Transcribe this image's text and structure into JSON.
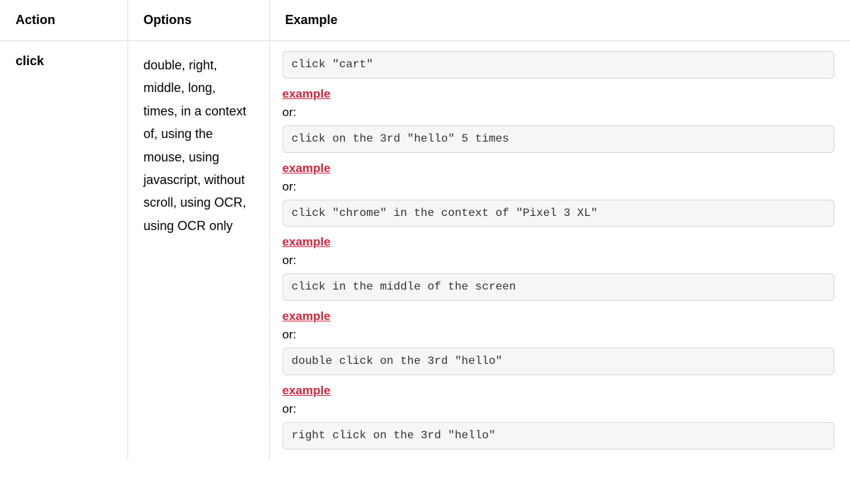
{
  "headers": {
    "action": "Action",
    "options": "Options",
    "example": "Example"
  },
  "row": {
    "action": "click",
    "options": "double, right, middle, long, times, in a context of, using the mouse, using javascript, without scroll, using OCR, using OCR only",
    "examples": [
      {
        "code": "click \"cart\"",
        "link": "example",
        "or": "or:"
      },
      {
        "code": "click on the 3rd \"hello\" 5 times",
        "link": "example",
        "or": "or:"
      },
      {
        "code": "click \"chrome\" in the context of \"Pixel 3 XL\"",
        "link": "example",
        "or": "or:"
      },
      {
        "code": "click in the middle of the screen",
        "link": "example",
        "or": "or:"
      },
      {
        "code": "double click on the 3rd \"hello\"",
        "link": "example",
        "or": "or:"
      },
      {
        "code": "right click on the 3rd \"hello\""
      }
    ]
  }
}
